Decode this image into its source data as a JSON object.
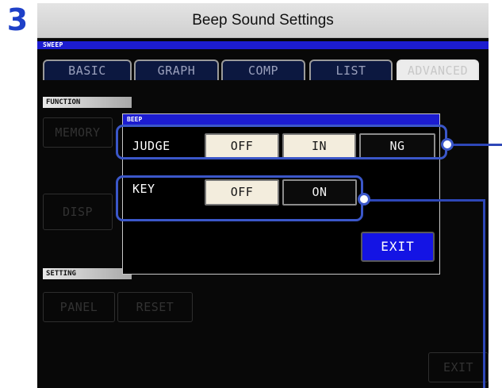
{
  "step": {
    "number": "3"
  },
  "banner": {
    "title": "Beep Sound Settings"
  },
  "screen": {
    "header": "SWEEP",
    "tabs": [
      {
        "label": "BASIC",
        "active": false
      },
      {
        "label": "GRAPH",
        "active": false
      },
      {
        "label": "COMP",
        "active": false
      },
      {
        "label": "LIST",
        "active": false
      },
      {
        "label": "ADVANCED",
        "active": true
      }
    ],
    "function_section": {
      "label": "FUNCTION",
      "buttons": {
        "memory": "MEMORY",
        "disp": "DISP"
      }
    },
    "setting_section": {
      "label": "SETTING",
      "buttons": {
        "panel": "PANEL",
        "reset": "RESET"
      }
    },
    "exit_label": "EXIT"
  },
  "dialog": {
    "title": "BEEP",
    "judge": {
      "label": "JUDGE",
      "options": [
        {
          "label": "OFF",
          "selected": false
        },
        {
          "label": "IN",
          "selected": false
        },
        {
          "label": "NG",
          "selected": true
        }
      ]
    },
    "key": {
      "label": "KEY",
      "options": [
        {
          "label": "OFF",
          "selected": false
        },
        {
          "label": "ON",
          "selected": true
        }
      ]
    },
    "exit_label": "EXIT"
  },
  "colors": {
    "accent_blue": "#1c1cd0",
    "callout_blue": "#3b57c9",
    "option_unselected": "#f3eddd",
    "option_selected": "#0b0b0b"
  }
}
